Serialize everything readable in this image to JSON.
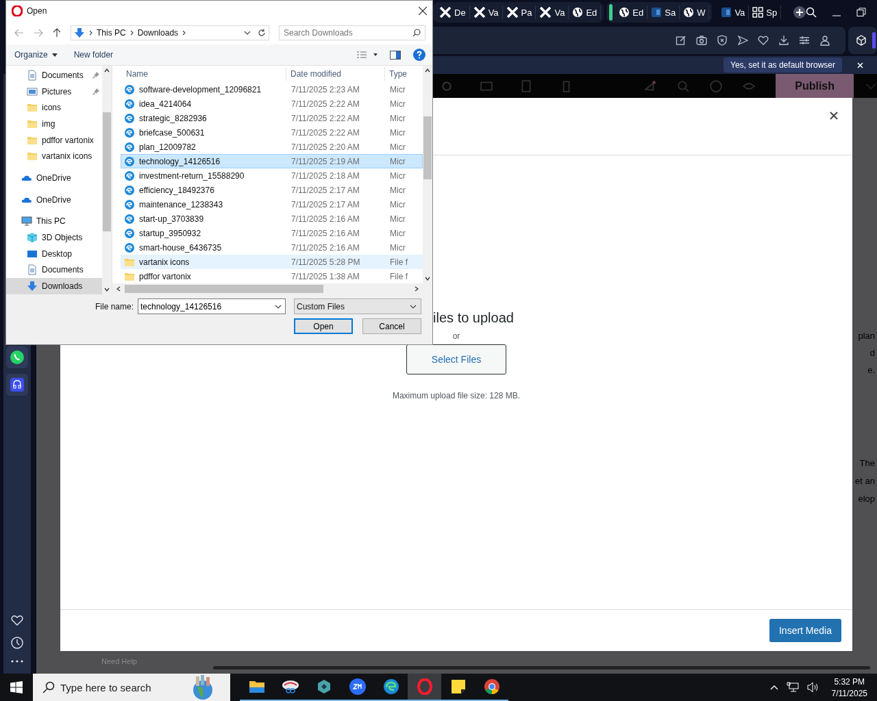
{
  "browser": {
    "tab_groups": [
      {
        "tabs": [
          {
            "label": "De",
            "kind": "x"
          },
          {
            "label": "Va",
            "kind": "x"
          },
          {
            "label": "Pa",
            "kind": "x"
          },
          {
            "label": "Va",
            "kind": "x"
          },
          {
            "label": "Ed",
            "kind": "globe"
          }
        ]
      },
      {
        "tabs": [
          {
            "label": "Ed",
            "kind": "globe"
          },
          {
            "label": "Sa",
            "kind": "doc"
          },
          {
            "label": "W",
            "kind": "globe"
          }
        ]
      },
      {
        "tabs": [
          {
            "label": "Va",
            "kind": "doc"
          },
          {
            "label": "Sp",
            "kind": "grid"
          }
        ]
      }
    ],
    "infobar": {
      "button": "Yes, set it as default browser"
    }
  },
  "editor": {
    "publish_button": "Publish",
    "background_texts": [
      "plan",
      "d",
      "e.",
      "The",
      "et an",
      "elop"
    ],
    "help_text": "Need Help"
  },
  "modal": {
    "drop_text": "iles to upload",
    "or_text": "or",
    "select_button": "Select Files",
    "max_size": "Maximum upload file size: 128 MB.",
    "insert_button": "Insert Media"
  },
  "dialog": {
    "title": "Open",
    "breadcrumb": [
      "This PC",
      "Downloads"
    ],
    "search": {
      "placeholder": "Search Downloads"
    },
    "toolbar": {
      "organize": "Organize",
      "new_folder": "New folder"
    },
    "nav": [
      {
        "label": "Documents",
        "kind": "docs",
        "pinned": true,
        "selected": false
      },
      {
        "label": "Pictures",
        "kind": "pictures",
        "pinned": true,
        "selected": false
      },
      {
        "label": "icons",
        "kind": "folder",
        "pinned": false,
        "selected": false
      },
      {
        "label": "img",
        "kind": "folder",
        "pinned": false,
        "selected": false
      },
      {
        "label": "pdffor vartonix",
        "kind": "folder",
        "pinned": false,
        "selected": false
      },
      {
        "label": "vartanix icons",
        "kind": "folder",
        "pinned": false,
        "selected": false
      },
      {
        "label": "OneDrive",
        "kind": "cloud",
        "pinned": false,
        "selected": false
      },
      {
        "label": "OneDrive",
        "kind": "cloud",
        "pinned": false,
        "selected": false
      },
      {
        "label": "This PC",
        "kind": "pc",
        "pinned": false,
        "selected": false,
        "children": [
          {
            "label": "3D Objects",
            "kind": "cube",
            "pinned": false,
            "selected": false
          },
          {
            "label": "Desktop",
            "kind": "desktop",
            "pinned": false,
            "selected": false
          },
          {
            "label": "Documents",
            "kind": "docs",
            "pinned": false,
            "selected": false
          },
          {
            "label": "Downloads",
            "kind": "download",
            "pinned": false,
            "selected": true
          }
        ]
      }
    ],
    "columns": [
      "Name",
      "Date modified",
      "Type"
    ],
    "rows": [
      {
        "name": "software-development_12096821",
        "date": "7/11/2025 2:23 AM",
        "type": "Micr",
        "kind": "edge",
        "selected": false,
        "hovered": false
      },
      {
        "name": "idea_4214064",
        "date": "7/11/2025 2:22 AM",
        "type": "Micr",
        "kind": "edge",
        "selected": false,
        "hovered": false
      },
      {
        "name": "strategic_8282936",
        "date": "7/11/2025 2:22 AM",
        "type": "Micr",
        "kind": "edge",
        "selected": false,
        "hovered": false
      },
      {
        "name": "briefcase_500631",
        "date": "7/11/2025 2:22 AM",
        "type": "Micr",
        "kind": "edge",
        "selected": false,
        "hovered": false
      },
      {
        "name": "plan_12009782",
        "date": "7/11/2025 2:20 AM",
        "type": "Micr",
        "kind": "edge",
        "selected": false,
        "hovered": false
      },
      {
        "name": "technology_14126516",
        "date": "7/11/2025 2:19 AM",
        "type": "Micr",
        "kind": "edge",
        "selected": true,
        "hovered": false
      },
      {
        "name": "investment-return_15588290",
        "date": "7/11/2025 2:18 AM",
        "type": "Micr",
        "kind": "edge",
        "selected": false,
        "hovered": false
      },
      {
        "name": "efficiency_18492376",
        "date": "7/11/2025 2:17 AM",
        "type": "Micr",
        "kind": "edge",
        "selected": false,
        "hovered": false
      },
      {
        "name": "maintenance_1238343",
        "date": "7/11/2025 2:17 AM",
        "type": "Micr",
        "kind": "edge",
        "selected": false,
        "hovered": false
      },
      {
        "name": "start-up_3703839",
        "date": "7/11/2025 2:16 AM",
        "type": "Micr",
        "kind": "edge",
        "selected": false,
        "hovered": false
      },
      {
        "name": "startup_3950932",
        "date": "7/11/2025 2:16 AM",
        "type": "Micr",
        "kind": "edge",
        "selected": false,
        "hovered": false
      },
      {
        "name": "smart-house_6436735",
        "date": "7/11/2025 2:16 AM",
        "type": "Micr",
        "kind": "edge",
        "selected": false,
        "hovered": false
      },
      {
        "name": "vartanix icons",
        "date": "7/11/2025 5:28 PM",
        "type": "File f",
        "kind": "folder",
        "selected": false,
        "hovered": true
      },
      {
        "name": "pdffor vartonix",
        "date": "7/11/2025 1:38 AM",
        "type": "File f",
        "kind": "folder",
        "selected": false,
        "hovered": false
      }
    ],
    "file_name_label": "File name:",
    "file_name": "technology_14126516",
    "filter": "Custom Files",
    "open_button": "Open",
    "cancel_button": "Cancel"
  },
  "taskbar": {
    "search": {
      "placeholder": "Type here to search"
    },
    "apps": [
      {
        "kind": "explorer",
        "active": false
      },
      {
        "kind": "snip",
        "active": false
      },
      {
        "kind": "cube",
        "active": false
      },
      {
        "kind": "zoom",
        "active": false
      },
      {
        "kind": "edge",
        "active": false
      },
      {
        "kind": "opera",
        "active": true
      },
      {
        "kind": "notes",
        "active": false
      },
      {
        "kind": "chrome",
        "active": false
      }
    ],
    "time": "5:32 PM",
    "date": "7/11/2025"
  }
}
